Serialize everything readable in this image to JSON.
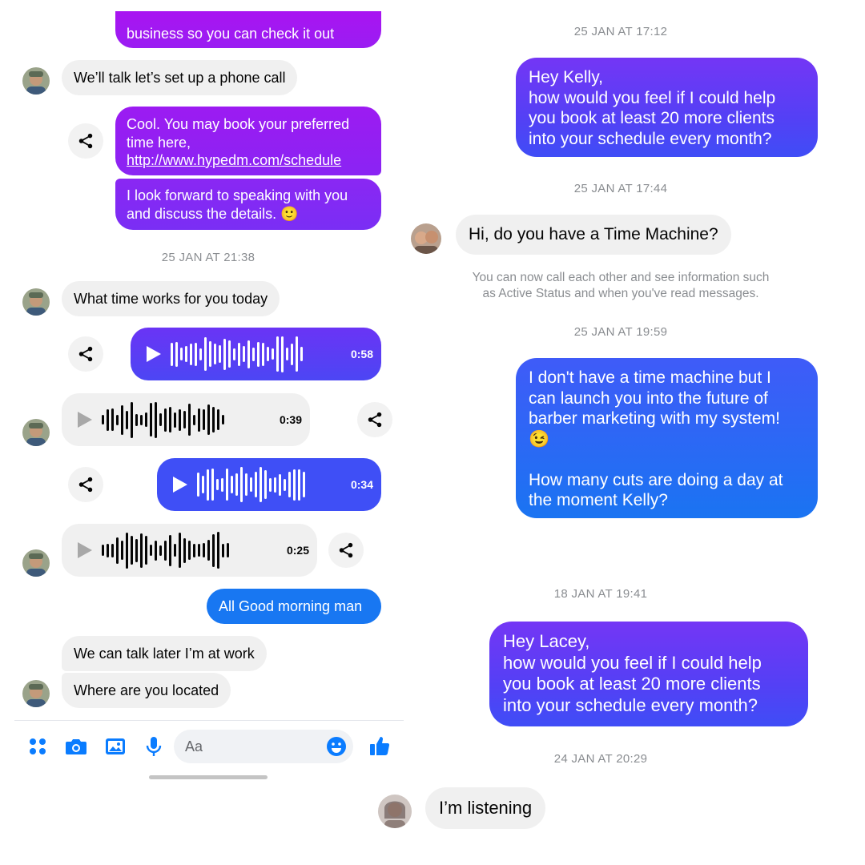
{
  "left": {
    "messages": {
      "top_partial": "business so you can check it out",
      "phone_call": "We’ll talk let’s set up a phone call",
      "book_line1": "Cool. You may book  your preferred",
      "book_line2": "time here,",
      "book_link": "http://www.hypedm.com/schedule",
      "forward_line1": "I look forward to speaking with you",
      "forward_line2": "and discuss the details. 🙂",
      "timestamp1": "25 JAN AT 21:38",
      "what_time": "What time works for you today",
      "audio1_duration": "0:58",
      "audio2_duration": "0:39",
      "audio3_duration": "0:34",
      "audio4_duration": "0:25",
      "good_morning": "All Good morning man",
      "talk_later": "We can talk later I’m at work",
      "located": "Where are you located"
    },
    "composer": {
      "placeholder": "Aa",
      "icons": [
        "apps-icon",
        "camera-icon",
        "image-icon",
        "mic-icon",
        "emoji-icon",
        "thumbs-up-icon"
      ]
    }
  },
  "right": {
    "ts1": "25 JAN AT 17:12",
    "kelly_lines": [
      "Hey Kelly,",
      "how would you feel if I could help",
      "you book at least 20 more clients",
      "into your schedule every month?"
    ],
    "ts2": "25 JAN AT 17:44",
    "time_machine": "Hi, do you have a Time Machine?",
    "notice_line1": "You can now call each other and see information such",
    "notice_line2": "as Active Status and when you've read messages.",
    "ts3": "25 JAN AT 19:59",
    "reply_lines": [
      "I don't have a time machine but I",
      "can launch you into the future of",
      "barber marketing with my system!",
      "😉",
      "",
      "How many cuts are doing a day at",
      "the moment Kelly?"
    ],
    "ts4": "18 JAN AT 19:41",
    "lacey_lines": [
      "Hey Lacey,",
      "how would you feel if I could help",
      "you book at least 20 more clients",
      "into your schedule every month?"
    ],
    "ts5": "24 JAN AT 20:29",
    "listening": "I’m listening"
  },
  "colors": {
    "messenger_blue": "#0a7cff",
    "purple": "#a21ff2",
    "incoming_bg": "#f0f0f0",
    "timestamp": "#8a8d91"
  }
}
